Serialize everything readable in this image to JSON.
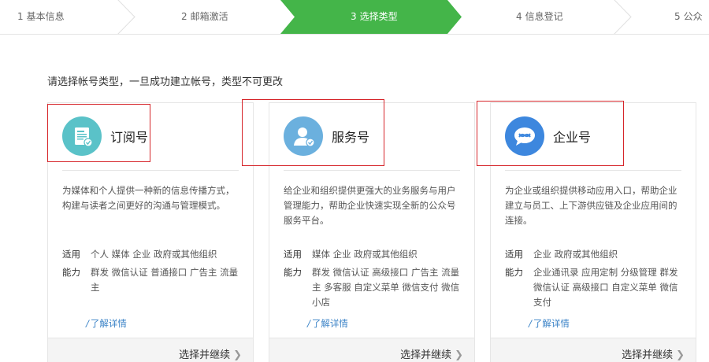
{
  "steps": [
    {
      "num": "1",
      "label": "基本信息"
    },
    {
      "num": "2",
      "label": "邮箱激活"
    },
    {
      "num": "3",
      "label": "选择类型"
    },
    {
      "num": "4",
      "label": "信息登记"
    },
    {
      "num": "5",
      "label": "公众号"
    }
  ],
  "colors": {
    "accent": "#44b549",
    "link": "#3b83c7",
    "highlight_border": "#d6252a"
  },
  "intro": "请选择帐号类型，一旦成功建立帐号，类型不可更改",
  "labels": {
    "applicable": "适用",
    "abilities": "能力"
  },
  "cards": [
    {
      "icon": "subscription-document-icon",
      "title": "订阅号",
      "desc": "为媒体和个人提供一种新的信息传播方式，构建与读者之间更好的沟通与管理模式。",
      "applicable": "个人 媒体 企业 政府或其他组织",
      "abilities": "群发 微信认证 普通接口 广告主 流量主",
      "more": "了解详情",
      "action": "选择并继续"
    },
    {
      "icon": "service-person-icon",
      "title": "服务号",
      "desc": "给企业和组织提供更强大的业务服务与用户管理能力，帮助企业快速实现全新的公众号服务平台。",
      "applicable": "媒体 企业 政府或其他组织",
      "abilities": "群发 微信认证 高级接口 广告主 流量主 多客服 自定义菜单 微信支付 微信小店",
      "more": "了解详情",
      "action": "选择并继续"
    },
    {
      "icon": "enterprise-chat-icon",
      "title": "企业号",
      "desc": "为企业或组织提供移动应用入口，帮助企业建立与员工、上下游供应链及企业应用间的连接。",
      "applicable": "企业 政府或其他组织",
      "abilities": "企业通讯录 应用定制 分级管理 群发 微信认证 高级接口 自定义菜单 微信支付",
      "more": "了解详情",
      "action": "选择并继续"
    }
  ]
}
